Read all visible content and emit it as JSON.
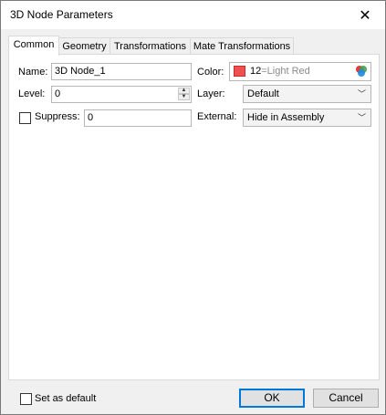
{
  "window": {
    "title": "3D Node Parameters",
    "close_glyph": "✕"
  },
  "tabs": [
    {
      "label": "Common",
      "active": true
    },
    {
      "label": "Geometry",
      "active": false
    },
    {
      "label": "Transformations",
      "active": false
    },
    {
      "label": "Mate Transformations",
      "active": false
    }
  ],
  "common": {
    "name_label": "Name:",
    "name_value": "3D Node_1",
    "level_label": "Level:",
    "level_value": "0",
    "suppress_label": "Suppress:",
    "suppress_checked": false,
    "suppress_value": "0",
    "color_label": "Color:",
    "color_number": "12",
    "color_name": "=Light Red",
    "color_swatch": "#f05050",
    "layer_label": "Layer:",
    "layer_value": "Default",
    "external_label": "External:",
    "external_value": "Hide in Assembly"
  },
  "footer": {
    "set_default_label": "Set as default",
    "set_default_checked": false,
    "ok_label": "OK",
    "cancel_label": "Cancel"
  },
  "icons": {
    "close": "close-icon",
    "palette": "color-palette-icon",
    "dropdown": "chevron-down-icon",
    "spin_up": "spin-up-icon",
    "spin_down": "spin-down-icon"
  },
  "colors": {
    "accent": "#0078d7",
    "panel_bg": "#ffffff",
    "dialog_bg": "#f0f0f0"
  }
}
